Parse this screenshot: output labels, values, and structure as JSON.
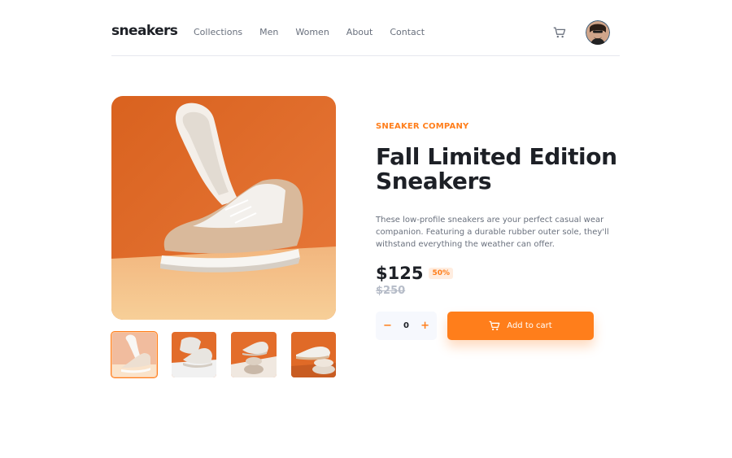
{
  "header": {
    "logo": "sneakers",
    "nav": [
      "Collections",
      "Men",
      "Women",
      "About",
      "Contact"
    ],
    "cart_icon": "cart-icon",
    "avatar": "user-avatar"
  },
  "product": {
    "company": "SNEAKER COMPANY",
    "title": "Fall Limited Edition Sneakers",
    "description": "These low-profile sneakers are your perfect casual wear companion. Featuring a durable rubber outer sole, they'll withstand everything the weather can offer.",
    "price": "$125",
    "discount": "50%",
    "old_price": "$250"
  },
  "quantity": {
    "minus": "−",
    "value": "0",
    "plus": "+"
  },
  "add_to_cart": {
    "label": "Add to cart"
  },
  "colors": {
    "accent": "#ff7e1b",
    "dark": "#1d2026",
    "gray": "#69707d"
  }
}
